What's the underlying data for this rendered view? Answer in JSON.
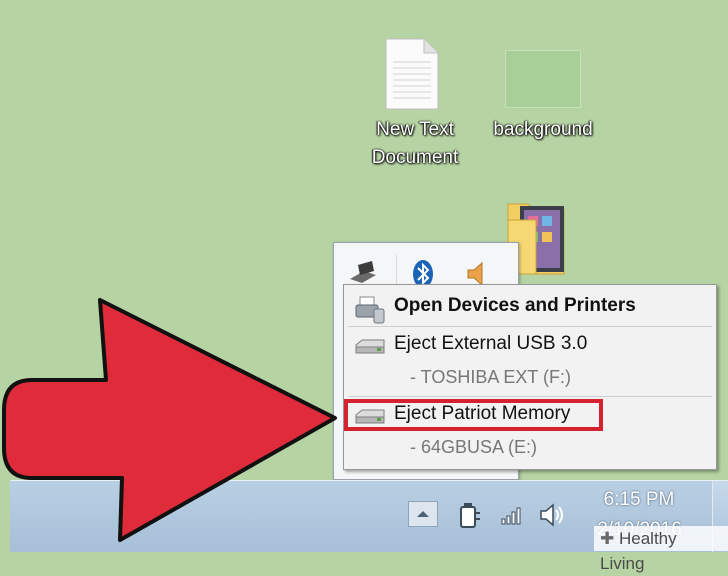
{
  "desktop": {
    "icons": [
      {
        "label_line1": "New Text",
        "label_line2": "Document"
      },
      {
        "label": "background"
      }
    ]
  },
  "context_menu": {
    "items": [
      {
        "label": "Open Devices and Printers"
      },
      {
        "label": "Eject External USB 3.0",
        "sub": "-   TOSHIBA EXT (F:)"
      },
      {
        "label": "Eject Patriot Memory",
        "sub": "-   64GBUSA (E:)"
      }
    ]
  },
  "taskbar": {
    "time": "6:15 PM",
    "date": "2/10/2016"
  },
  "watermark": {
    "text": "Healthy Living"
  },
  "colors": {
    "desktop": "#b6d4a3",
    "arrow": "#e02c3a",
    "highlight": "#d52230",
    "taskbar": "#b3cbe0"
  },
  "icons": [
    "text-document-icon",
    "folder-icon",
    "printer-icon",
    "bluetooth-icon",
    "volume-icon",
    "usb-drive-icon",
    "power-icon",
    "signal-icon",
    "speaker-icon"
  ]
}
